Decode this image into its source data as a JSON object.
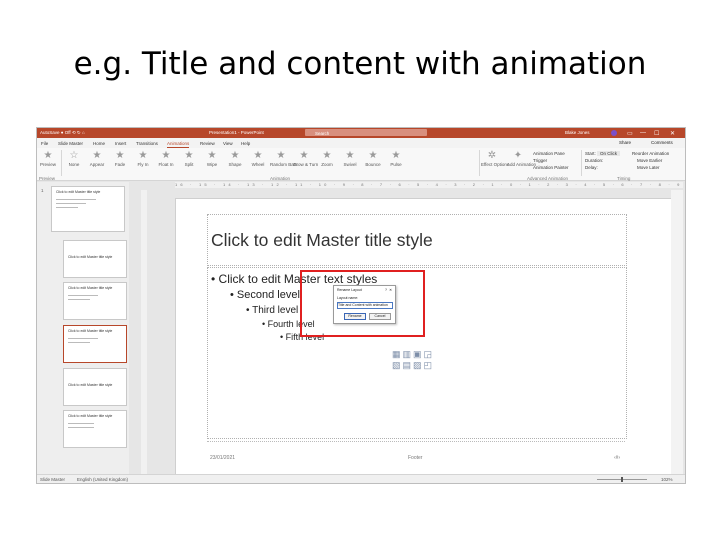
{
  "slide": {
    "title": "e.g. Title and content with animation"
  },
  "titlebar": {
    "autosave": "AutoSave ● Off ⟲ ↻ ⌂",
    "document": "Presentation1 - PowerPoint",
    "search_placeholder": "Search",
    "user": "Blake Jones",
    "controls": [
      "▭",
      "—",
      "☐",
      "✕"
    ]
  },
  "tabs": [
    "File",
    "Slide Master",
    "Home",
    "Insert",
    "Transitions",
    "Animations",
    "Review",
    "View",
    "Help"
  ],
  "active_tab": "Animations",
  "share": "Share",
  "comments": "Comments",
  "ribbon": {
    "preview": "Preview",
    "effects": [
      "None",
      "Appear",
      "Fade",
      "Fly In",
      "Float In",
      "Split",
      "Wipe",
      "Shape",
      "Wheel",
      "Random Bars",
      "Grow & Turn",
      "Zoom",
      "Swivel",
      "Bounce",
      "Pulse"
    ],
    "effect_options": "Effect Options",
    "add_animation": "Add Animation",
    "advanced": [
      "Animation Pane",
      "Trigger",
      "Animation Painter"
    ],
    "start_label": "Start:",
    "start_value": "On Click",
    "duration_label": "Duration:",
    "delay_label": "Delay:",
    "reorder": [
      "Reorder Animation",
      "Move Earlier",
      "Move Later"
    ],
    "groups": [
      "Preview",
      "Animation",
      "Advanced Animation",
      "Timing"
    ]
  },
  "ruler": "16 · 15 · 14 · 13 · 12 · 11 · 10 · 9 · 8 · 7 · 6 · 5 · 4 · 3 · 2 · 1 · 0 · 1 · 2 · 3 · 4 · 5 · 6 · 7 · 8 · 9 · 10 · 11 · 12 · 13 · 14 · 15 · 16",
  "thumbnails": [
    {
      "num": "1",
      "title": "Click to edit Master title style"
    },
    {
      "num": "",
      "title": "Click to edit Master title style"
    },
    {
      "num": "",
      "title": "Click to edit Master title style"
    },
    {
      "num": "",
      "title": "Click to edit Master title style"
    },
    {
      "num": "",
      "title": "Click to edit Master title style"
    },
    {
      "num": "",
      "title": "Click to edit Master title style"
    }
  ],
  "master": {
    "title": "Click to edit Master title style",
    "levels": [
      "• Click to edit Master text styles",
      "• Second level",
      "• Third level",
      "• Fourth level",
      "• Fifth level"
    ],
    "date": "23/01/2021",
    "footer": "Footer",
    "page": "‹#›"
  },
  "dialog": {
    "title": "Rename Layout",
    "help": "?",
    "close": "✕",
    "label": "Layout name:",
    "value": "Title and Content with animation",
    "rename": "Rename",
    "cancel": "Cancel"
  },
  "statusbar": {
    "left": "Slide Master",
    "lang": "English (United Kingdom)",
    "zoom": "102%"
  }
}
